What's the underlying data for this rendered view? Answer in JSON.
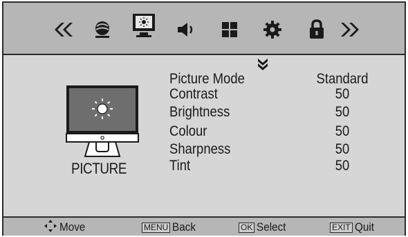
{
  "topbar": {
    "items": [
      {
        "icon": "double-chevron-left-icon"
      },
      {
        "icon": "channel-icon"
      },
      {
        "icon": "picture-icon",
        "selected": true
      },
      {
        "icon": "sound-icon"
      },
      {
        "icon": "setup-icon"
      },
      {
        "icon": "settings-gear-icon"
      },
      {
        "icon": "lock-icon"
      },
      {
        "icon": "double-chevron-right-icon"
      }
    ]
  },
  "category": {
    "label": "PICTURE",
    "icon": "monitor-brightness-icon"
  },
  "menu": {
    "more_icon": "double-chevron-down-icon",
    "rows": [
      {
        "label": "Picture Mode",
        "value": "Standard"
      },
      {
        "label": "Contrast",
        "value": "50"
      },
      {
        "label": "Brightness",
        "value": "50"
      },
      {
        "label": "Colour",
        "value": "50"
      },
      {
        "label": "Sharpness",
        "value": "50"
      },
      {
        "label": "Tint",
        "value": "50"
      }
    ]
  },
  "hints": {
    "move": {
      "icon": "four-way-arrow-icon",
      "text": "Move"
    },
    "back": {
      "key": "MENU",
      "text": "Back"
    },
    "select": {
      "key": "OK",
      "text": "Select"
    },
    "quit": {
      "key": "EXIT",
      "text": "Quit"
    }
  },
  "colors": {
    "panel": "#d6d6d6",
    "bar": "#b6b6b6",
    "border": "#2b2b2b",
    "text": "#1a1a1a"
  }
}
